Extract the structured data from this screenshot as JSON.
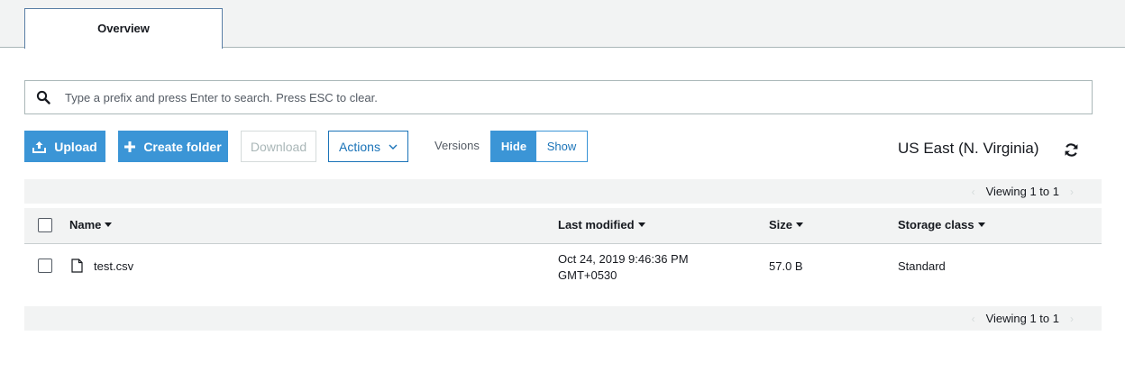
{
  "tabs": [
    {
      "label": "Overview",
      "active": true
    }
  ],
  "search": {
    "placeholder": "Type a prefix and press Enter to search. Press ESC to clear.",
    "value": "",
    "icon": "search-icon"
  },
  "toolbar": {
    "upload_label": "Upload",
    "upload_icon": "upload-icon",
    "create_folder_label": "Create folder",
    "create_folder_icon": "plus-icon",
    "download_label": "Download",
    "actions_label": "Actions",
    "actions_icon": "chevron-down-icon",
    "versions_label": "Versions",
    "versions_hide": "Hide",
    "versions_show": "Show",
    "versions_selected": "Hide"
  },
  "region": "US East (N. Virginia)",
  "pagination_top": {
    "text": "Viewing 1 to 1"
  },
  "pagination_bottom": {
    "text": "Viewing 1 to 1"
  },
  "table": {
    "columns": [
      "Name",
      "Last modified",
      "Size",
      "Storage class"
    ],
    "rows": [
      {
        "name": "test.csv",
        "type_icon": "file-icon",
        "modified_line1": "Oct 24, 2019 9:46:36 PM",
        "modified_line2": "GMT+0530",
        "size": "57.0 B",
        "storage_class": "Standard"
      }
    ]
  },
  "colors": {
    "primary": "#3b95d6",
    "link": "#1a73b8",
    "header_bg": "#f2f3f3",
    "border": "#aab7b8"
  }
}
